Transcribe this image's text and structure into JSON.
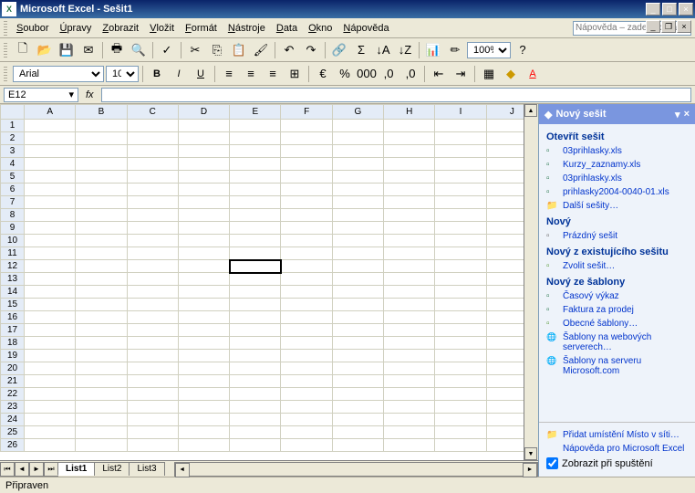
{
  "titlebar": {
    "app": "Microsoft Excel",
    "doc": "Sešit1"
  },
  "menus": [
    "Soubor",
    "Úpravy",
    "Zobrazit",
    "Vložit",
    "Formát",
    "Nástroje",
    "Data",
    "Okno",
    "Nápověda"
  ],
  "help_placeholder": "Nápověda – zadejte dotaz",
  "toolbar": {
    "font": "Arial",
    "size": "10",
    "zoom": "100%"
  },
  "formula": {
    "name_box": "E12",
    "fx": "fx"
  },
  "columns": [
    "A",
    "B",
    "C",
    "D",
    "E",
    "F",
    "G",
    "H",
    "I",
    "J"
  ],
  "rows_count": 26,
  "selected_cell": {
    "row": 12,
    "col": "E"
  },
  "sheet_tabs": [
    "List1",
    "List2",
    "List3"
  ],
  "active_tab": 0,
  "taskpane": {
    "title": "Nový sešit",
    "open_title": "Otevřít sešit",
    "open_items": [
      "03prihlasky.xls",
      "Kurzy_zaznamy.xls",
      "03prihlasky.xls",
      "prihlasky2004-0040-01.xls"
    ],
    "open_more": "Další sešity…",
    "new_title": "Nový",
    "new_blank": "Prázdný sešit",
    "from_existing_title": "Nový z existujícího sešitu",
    "choose": "Zvolit sešit…",
    "template_title": "Nový ze šablony",
    "templates": [
      "Časový výkaz",
      "Faktura za prodej"
    ],
    "general_templates": "Obecné šablony…",
    "web_templates": "Šablony na webových serverech…",
    "ms_templates": "Šablony na serveru Microsoft.com",
    "footer_add": "Přidat umístění Místo v síti…",
    "footer_help": "Nápověda pro Microsoft Excel",
    "footer_show": "Zobrazit při spuštění"
  },
  "statusbar": {
    "text": "Připraven"
  }
}
